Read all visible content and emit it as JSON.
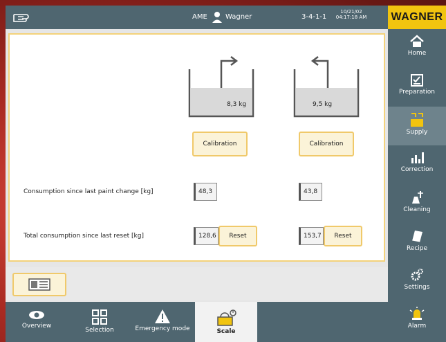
{
  "topbar": {
    "user_code": "AME",
    "user_name": "Wagner",
    "version": "3-4-1-1",
    "date": "10/21/02",
    "time": "04:17:18 AM",
    "logo": "WAGNER"
  },
  "sidebar": {
    "items": [
      {
        "label": "Home",
        "icon": "home-icon"
      },
      {
        "label": "Preparation",
        "icon": "checklist-icon"
      },
      {
        "label": "Supply",
        "icon": "supply-icon",
        "active": true
      },
      {
        "label": "Correction",
        "icon": "bar-chart-icon"
      },
      {
        "label": "Cleaning",
        "icon": "cleaning-icon"
      },
      {
        "label": "Recipe",
        "icon": "recipe-book-icon"
      },
      {
        "label": "Settings",
        "icon": "gears-icon"
      },
      {
        "label": "Alarm",
        "icon": "alarm-icon"
      }
    ]
  },
  "tanks": [
    {
      "weight": "8,3 kg",
      "calibration_label": "Calibration",
      "consumption_since_change": "48,3",
      "total_consumption": "128,6",
      "reset_label": "Reset"
    },
    {
      "weight": "9,5 kg",
      "calibration_label": "Calibration",
      "consumption_since_change": "43,8",
      "total_consumption": "153,7",
      "reset_label": "Reset"
    }
  ],
  "labels": {
    "consumption_since_change": "Consumption since last paint change [kg]",
    "total_consumption": "Total consumption since last reset [kg]"
  },
  "bottomnav": {
    "items": [
      {
        "label": "Overview",
        "icon": "eye-icon"
      },
      {
        "label": "Selection",
        "icon": "grid-icon"
      },
      {
        "label": "Emergency mode",
        "icon": "warning-icon"
      },
      {
        "label": "Scale",
        "icon": "scale-icon",
        "active": true
      }
    ]
  },
  "colors": {
    "panel": "#4f6670",
    "accent": "#f0c96a",
    "logo_bg": "#f1c40f"
  }
}
